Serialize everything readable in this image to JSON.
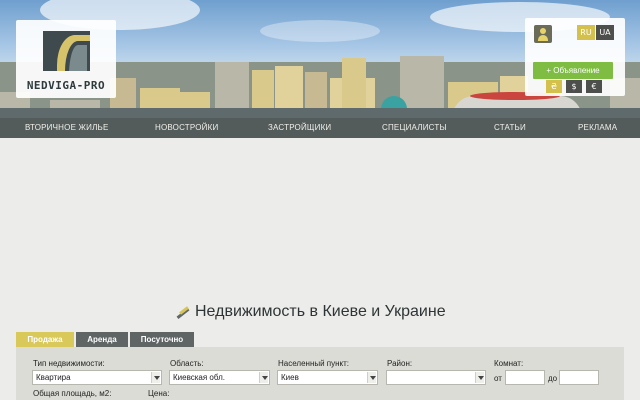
{
  "header": {
    "logo_text": "NEDVIGA-PRO",
    "lang": {
      "ru": "RU",
      "ua": "UA"
    },
    "add_ad_label": "+ Объявление",
    "currencies": [
      "₴",
      "$",
      "€"
    ]
  },
  "nav": {
    "items": [
      "ВТОРИЧНОЕ ЖИЛЬЕ",
      "НОВОСТРОЙКИ",
      "ЗАСТРОЙЩИКИ",
      "СПЕЦИАЛИСТЫ",
      "СТАТЬИ",
      "РЕКЛАМА"
    ]
  },
  "main": {
    "title": "Недвижимость в Киеве и Украине",
    "tabs": [
      "Продажа",
      "Аренда",
      "Посуточно"
    ],
    "active_tab": "Продажа"
  },
  "search": {
    "type_label": "Тип недвижимости:",
    "type_value": "Квартира",
    "region_label": "Область:",
    "region_value": "Киевская обл.",
    "city_label": "Населенный пункт:",
    "city_value": "Киев",
    "district_label": "Район:",
    "district_value": "",
    "rooms_label": "Комнат:",
    "from_label": "от",
    "to_label": "до",
    "area_label": "Общая площадь, м2:",
    "price_label": "Цена:"
  },
  "colors": {
    "accent": "#d9c85a",
    "nav_bg": "#545b5b",
    "add_button": "#7ebd42",
    "page_bg": "#ececea"
  }
}
